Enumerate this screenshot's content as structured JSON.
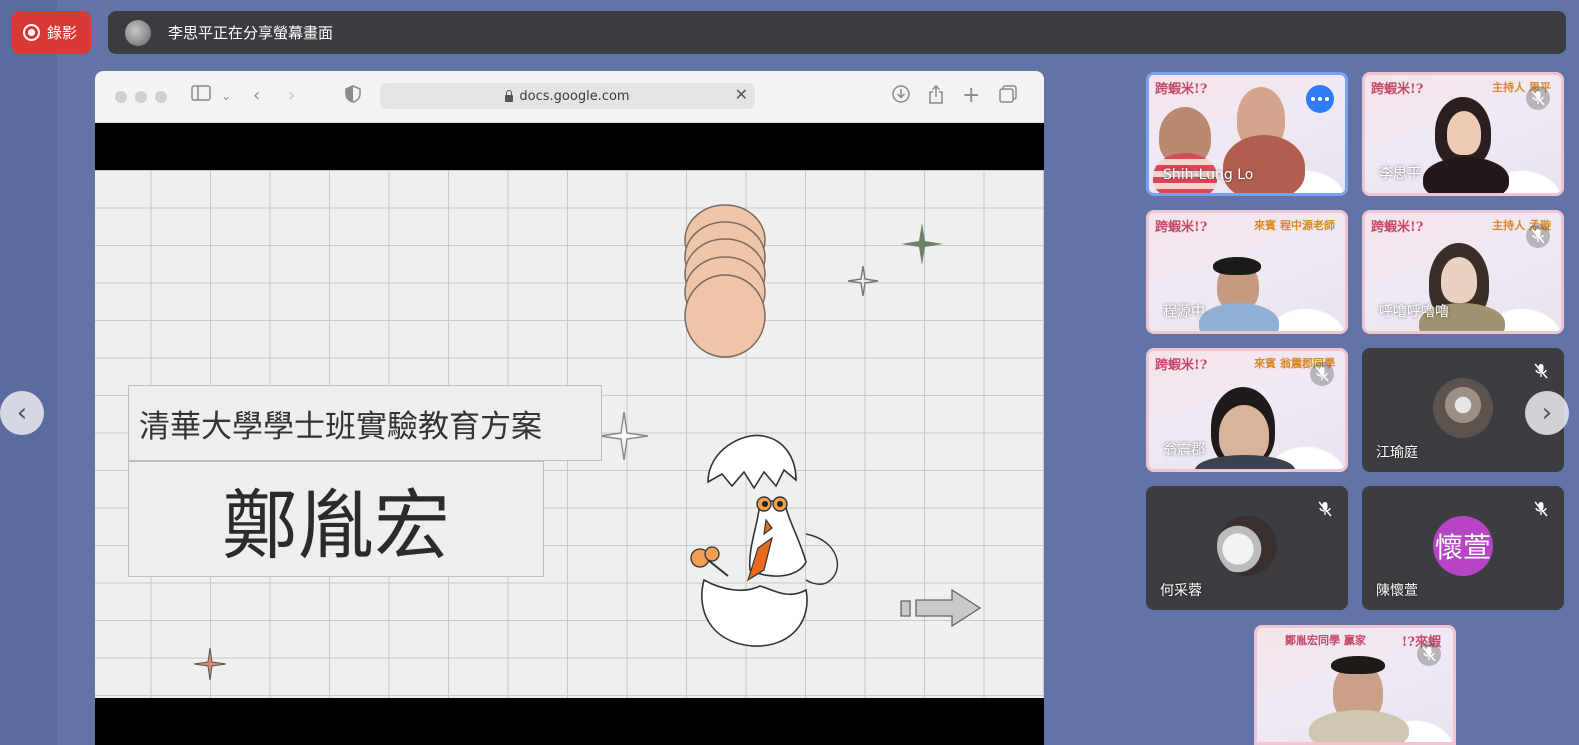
{
  "recording": {
    "label": "錄影",
    "color": "#d93934"
  },
  "share_banner": {
    "text": "李思平正在分享螢幕畫面"
  },
  "browser": {
    "url": "docs.google.com"
  },
  "slide": {
    "subtitle": "清華大學學士班實驗教育方案",
    "name": "鄭胤宏"
  },
  "participants": [
    {
      "name": "Shih-Lung Lo",
      "type": "video",
      "banner": "跨蝦米!?",
      "active": true
    },
    {
      "name": "李思平",
      "type": "video",
      "banner": "跨蝦米!?",
      "host_label": "主持人 思平"
    },
    {
      "name": "程源中",
      "type": "video",
      "banner": "跨蝦米!?",
      "host_label": "來賓 程中源老師"
    },
    {
      "name": "呼嚕呼嚕嚕",
      "type": "video",
      "banner": "跨蝦米!?",
      "host_label": "主持人 孟璇"
    },
    {
      "name": "翁震郡",
      "type": "video",
      "banner": "跨蝦米!?",
      "host_label": "來賓 翁震郡同學"
    },
    {
      "name": "江瑜庭",
      "type": "avatar"
    },
    {
      "name": "何采蓉",
      "type": "avatar"
    },
    {
      "name": "陳懷萱",
      "type": "letter",
      "letter": "懷萱",
      "color": "#b644c5"
    },
    {
      "name": "",
      "type": "video",
      "banner": "!?來蝦",
      "host_label": "鄭胤宏同學 贏家"
    }
  ]
}
